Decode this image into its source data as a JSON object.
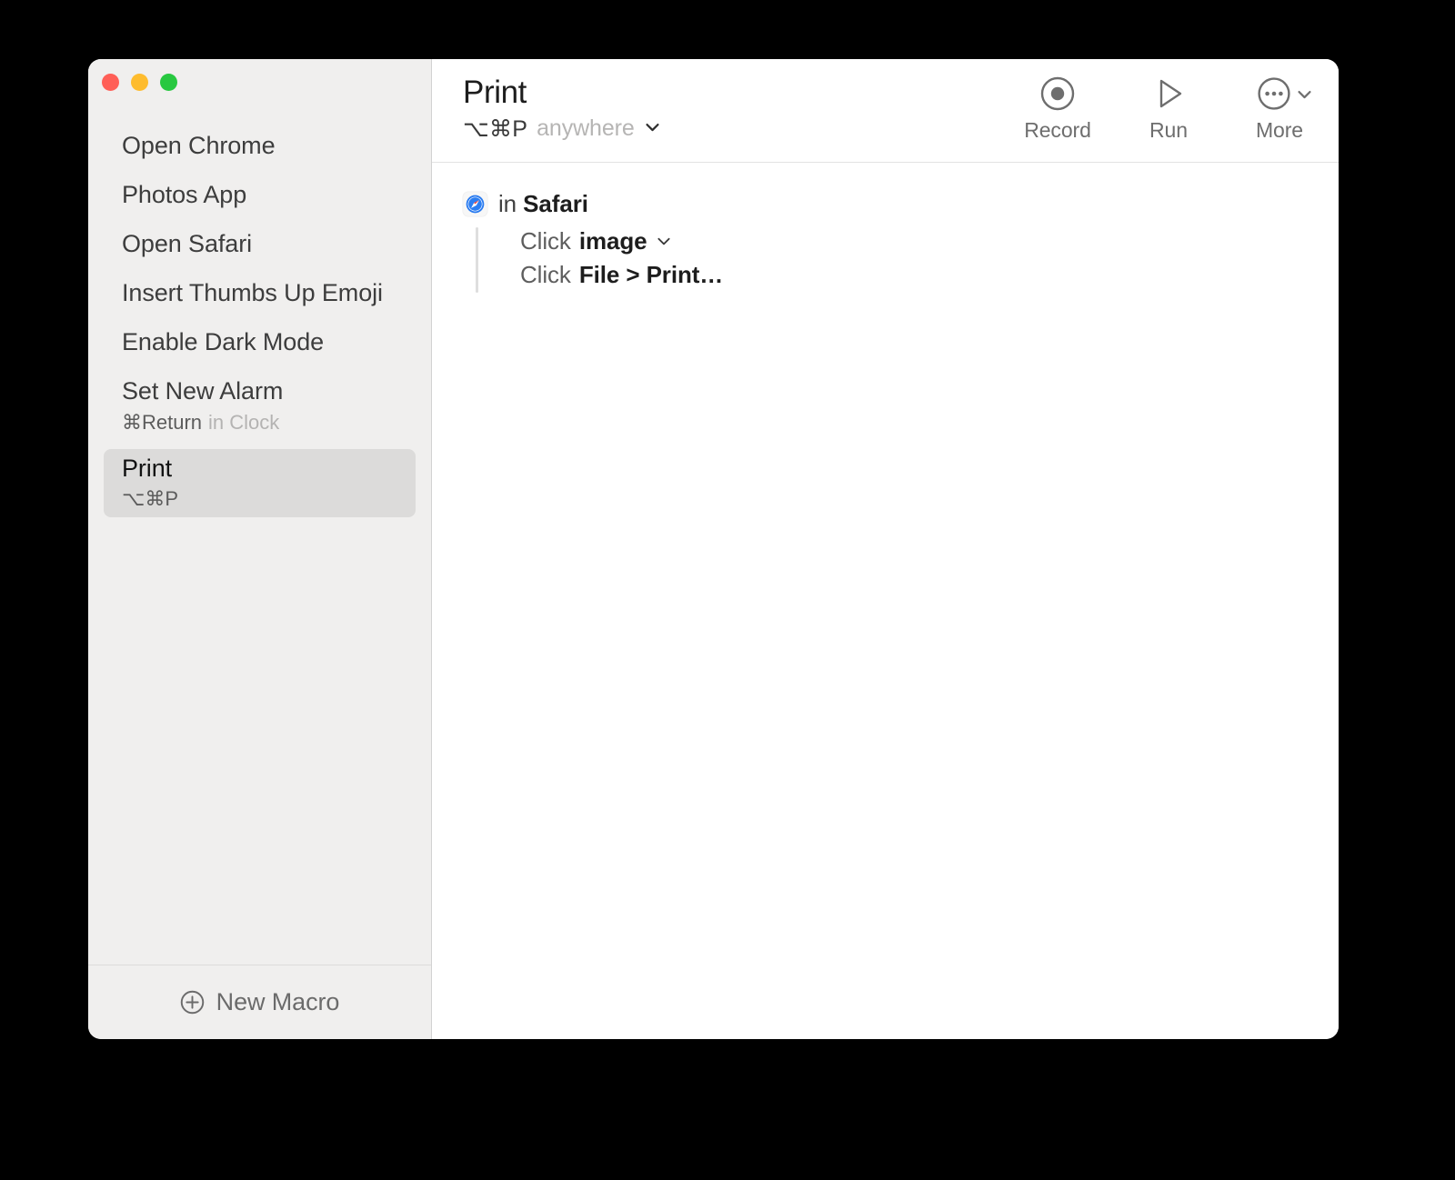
{
  "window": {
    "traffic_lights": [
      {
        "name": "close",
        "color": "#ff5f57"
      },
      {
        "name": "minimize",
        "color": "#febc2e"
      },
      {
        "name": "maximize",
        "color": "#28c840"
      }
    ]
  },
  "sidebar": {
    "macros": [
      {
        "title": "Open Chrome",
        "shortcut": "",
        "scope": ""
      },
      {
        "title": "Photos App",
        "shortcut": "",
        "scope": ""
      },
      {
        "title": "Open Safari",
        "shortcut": "",
        "scope": ""
      },
      {
        "title": "Insert Thumbs Up Emoji",
        "shortcut": "",
        "scope": ""
      },
      {
        "title": "Enable Dark Mode",
        "shortcut": "",
        "scope": ""
      },
      {
        "title": "Set New Alarm",
        "shortcut": "⌘Return",
        "scope": "in Clock"
      },
      {
        "title": "Print",
        "shortcut": "⌥⌘P",
        "scope": "",
        "selected": true
      }
    ],
    "footer": {
      "new_macro_label": "New Macro",
      "new_macro_icon": "plus-circle-icon"
    }
  },
  "header": {
    "macro_name": "Print",
    "shortcut": "⌥⌘P",
    "scope": "anywhere",
    "scope_chevron": "chevron-down-icon",
    "toolbar": [
      {
        "label": "Record",
        "icon": "record-icon",
        "chevron": false
      },
      {
        "label": "Run",
        "icon": "play-icon",
        "chevron": false
      },
      {
        "label": "More",
        "icon": "ellipsis-circle-icon",
        "chevron": true
      }
    ]
  },
  "script": {
    "context": {
      "icon": "safari-icon",
      "prefix": "in",
      "app": "Safari"
    },
    "steps": [
      {
        "verb": "Click",
        "target": "image",
        "chevron": true
      },
      {
        "verb": "Click",
        "target": "File > Print…",
        "chevron": false
      }
    ]
  },
  "colors": {
    "sidebar_bg": "#f0efee",
    "selected_row": "#dcdbda",
    "accent_blue": "#2a7bf0",
    "traffic_red": "#ff5f57",
    "traffic_yellow": "#febc2e",
    "traffic_green": "#28c840"
  }
}
